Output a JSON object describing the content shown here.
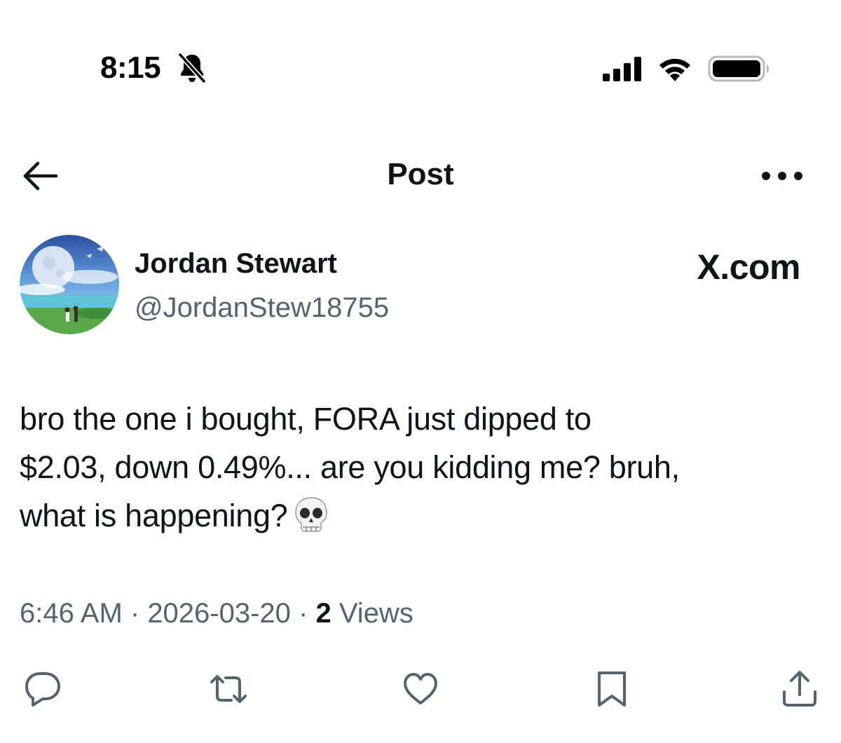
{
  "status_bar": {
    "time": "8:15",
    "icons": [
      "bell-slash-icon",
      "cellular-signal-icon",
      "wifi-icon",
      "battery-icon"
    ]
  },
  "nav": {
    "back_icon": "arrow-left-icon",
    "title": "Post",
    "more_icon": "more-horizontal-icon"
  },
  "author": {
    "display_name": "Jordan Stewart",
    "handle": "@JordanStew18755",
    "source_label": "X.com"
  },
  "post": {
    "lines": [
      "bro the one i bought, FORA just dipped to",
      "$2.03, down 0.49%... are you kidding me? bruh,",
      "what is happening?"
    ],
    "emoji": "💀"
  },
  "meta": {
    "time": "6:46 AM",
    "separator": " · ",
    "date": "2026-03-20",
    "views_count": "2",
    "views_label": "Views"
  },
  "actions": [
    {
      "name": "reply",
      "icon": "comment-icon"
    },
    {
      "name": "repost",
      "icon": "retweet-icon"
    },
    {
      "name": "like",
      "icon": "heart-icon"
    },
    {
      "name": "bookmark",
      "icon": "bookmark-icon"
    },
    {
      "name": "share",
      "icon": "share-icon"
    }
  ],
  "colors": {
    "text_primary": "#0f1419",
    "text_secondary": "#536471",
    "background": "#ffffff"
  }
}
